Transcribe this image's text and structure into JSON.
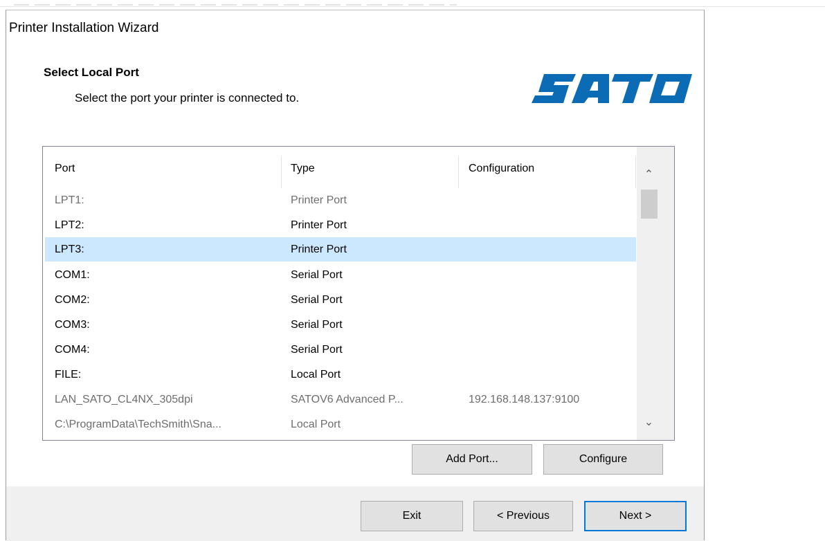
{
  "window": {
    "title": "Printer Installation Wizard"
  },
  "header": {
    "heading": "Select Local Port",
    "subheading": "Select the port your printer is connected to.",
    "logo_text": "SATO",
    "logo_color": "#0b6cb5"
  },
  "port_list": {
    "columns": [
      "Port",
      "Type",
      "Configuration"
    ],
    "rows": [
      {
        "port": "LPT1:",
        "type": "Printer Port",
        "configuration": "",
        "state": "disabled"
      },
      {
        "port": "LPT2:",
        "type": "Printer Port",
        "configuration": "",
        "state": "normal"
      },
      {
        "port": "LPT3:",
        "type": "Printer Port",
        "configuration": "",
        "state": "selected"
      },
      {
        "port": "COM1:",
        "type": "Serial Port",
        "configuration": "",
        "state": "normal"
      },
      {
        "port": "COM2:",
        "type": "Serial Port",
        "configuration": "",
        "state": "normal"
      },
      {
        "port": "COM3:",
        "type": "Serial Port",
        "configuration": "",
        "state": "normal"
      },
      {
        "port": "COM4:",
        "type": "Serial Port",
        "configuration": "",
        "state": "normal"
      },
      {
        "port": "FILE:",
        "type": "Local Port",
        "configuration": "",
        "state": "normal"
      },
      {
        "port": "LAN_SATO_CL4NX_305dpi",
        "type": "SATOV6 Advanced P...",
        "configuration": "192.168.148.137:9100",
        "state": "disabled"
      },
      {
        "port": "C:\\ProgramData\\TechSmith\\Sna...",
        "type": "Local Port",
        "configuration": "",
        "state": "disabled"
      }
    ],
    "scrollbar": {
      "up_icon": "chevron-up-icon",
      "down_icon": "chevron-down-icon"
    }
  },
  "actions": {
    "add_port": "Add Port...",
    "configure": "Configure"
  },
  "footer": {
    "exit": "Exit",
    "previous": "< Previous",
    "next": "Next >"
  },
  "colors": {
    "selection": "#cce8ff",
    "default_button_border": "#0078d7",
    "footer_background": "#f0f0f0"
  }
}
